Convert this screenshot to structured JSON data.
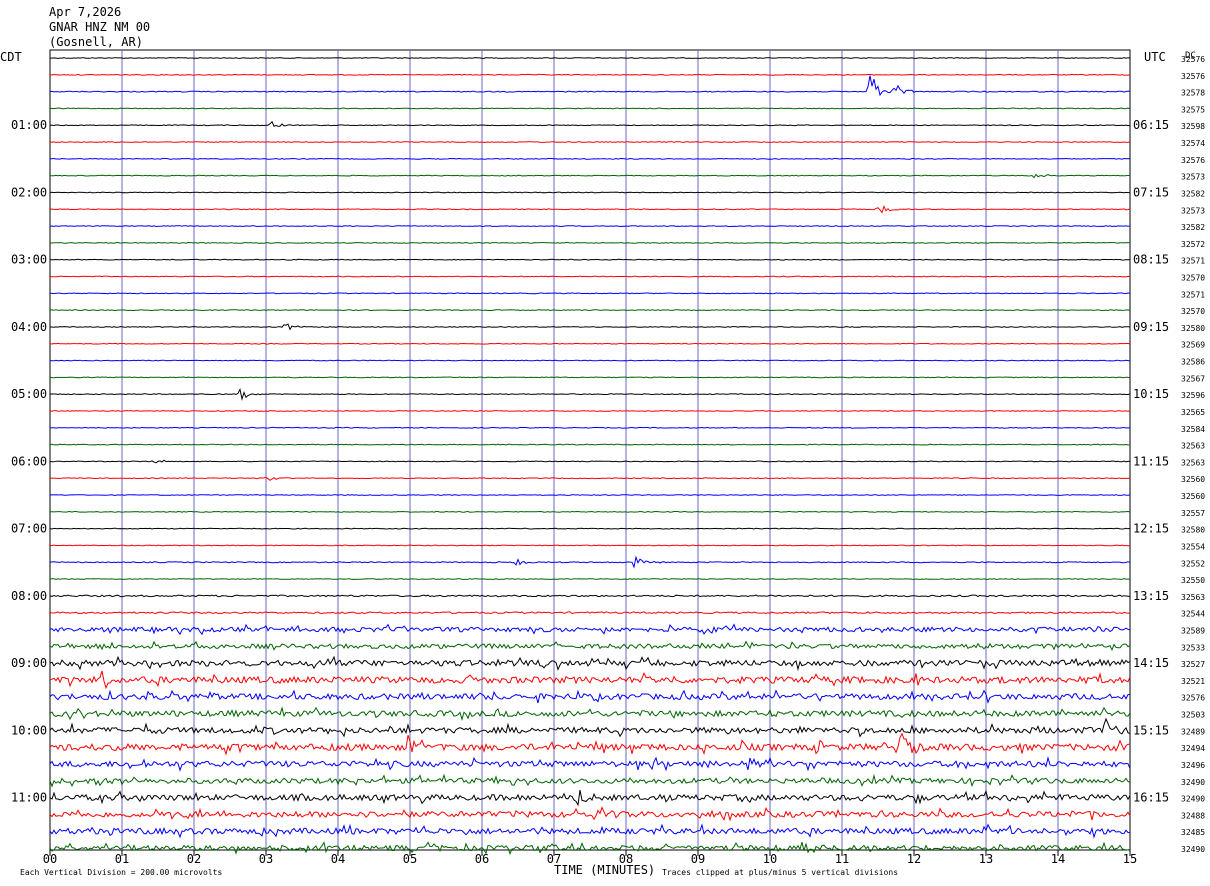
{
  "header": {
    "date": "Apr 7,2026",
    "station": "GNAR HNZ NM 00",
    "location": "(Gosnell, AR)"
  },
  "left_axis_label": "CDT",
  "right_axis_label": "UTC",
  "dc_label": "DC",
  "footer": {
    "scale_note": "Each Vertical Division =  200.00 microvolts",
    "xlabel": "TIME (MINUTES)",
    "clip_note": "Traces clipped at plus/minus 5 vertical divisions"
  },
  "colors": {
    "trace_cycle": [
      "#000000",
      "#ff0000",
      "#0000ff",
      "#006400"
    ],
    "grid": "#6a6ab8"
  },
  "chart_data": {
    "type": "line",
    "title": "",
    "xlabel": "TIME (MINUTES)",
    "ylabel": "",
    "xlim": [
      0,
      15
    ],
    "x_ticks": [
      "00",
      "01",
      "02",
      "03",
      "04",
      "05",
      "06",
      "07",
      "08",
      "09",
      "10",
      "11",
      "12",
      "13",
      "14",
      "15"
    ],
    "trace_count": 48,
    "left_hour_labels": [
      "01:00",
      "02:00",
      "03:00",
      "04:00",
      "05:00",
      "06:00",
      "07:00",
      "08:00",
      "09:00",
      "10:00",
      "11:00"
    ],
    "right_hour_labels": [
      "06:15",
      "07:15",
      "08:15",
      "09:15",
      "10:15",
      "11:15",
      "12:15",
      "13:15",
      "14:15",
      "15:15",
      "16:15"
    ],
    "dc_offsets": [
      "32576",
      "32576",
      "32578",
      "32575",
      "32598",
      "32574",
      "32576",
      "32573",
      "32582",
      "32573",
      "32582",
      "32572",
      "32571",
      "32570",
      "32571",
      "32570",
      "32580",
      "32569",
      "32586",
      "32567",
      "32596",
      "32565",
      "32584",
      "32563",
      "32563",
      "32560",
      "32560",
      "32557",
      "32580",
      "32554",
      "32552",
      "32550",
      "32563",
      "32544",
      "32589",
      "32533",
      "32527",
      "32521",
      "32576",
      "32503",
      "32489",
      "32494",
      "32496",
      "32490",
      "32490",
      "32488",
      "32485",
      "32490"
    ],
    "activity_levels": [
      0.12,
      0.12,
      0.15,
      0.12,
      0.12,
      0.12,
      0.12,
      0.12,
      0.12,
      0.12,
      0.12,
      0.12,
      0.12,
      0.12,
      0.12,
      0.12,
      0.12,
      0.12,
      0.12,
      0.12,
      0.12,
      0.12,
      0.12,
      0.12,
      0.12,
      0.12,
      0.12,
      0.12,
      0.12,
      0.12,
      0.15,
      0.12,
      0.25,
      0.25,
      0.7,
      0.7,
      0.9,
      1.0,
      0.9,
      0.9,
      0.9,
      1.0,
      0.9,
      0.8,
      0.9,
      0.9,
      0.9,
      0.8
    ],
    "events": [
      {
        "trace": 2,
        "minute": 11.4,
        "amplitude": 2.8
      },
      {
        "trace": 2,
        "minute": 11.75,
        "amplitude": 1.2
      },
      {
        "trace": 4,
        "minute": 3.1,
        "amplitude": 0.5
      },
      {
        "trace": 9,
        "minute": 11.5,
        "amplitude": 1.0
      },
      {
        "trace": 7,
        "minute": 13.7,
        "amplitude": 0.4
      },
      {
        "trace": 16,
        "minute": 3.3,
        "amplitude": 0.4
      },
      {
        "trace": 20,
        "minute": 2.65,
        "amplitude": 0.8
      },
      {
        "trace": 24,
        "minute": 1.45,
        "amplitude": 0.4
      },
      {
        "trace": 25,
        "minute": 3.0,
        "amplitude": 0.4
      },
      {
        "trace": 30,
        "minute": 6.5,
        "amplitude": 0.4
      },
      {
        "trace": 30,
        "minute": 8.15,
        "amplitude": 0.7
      },
      {
        "trace": 37,
        "minute": 0.75,
        "amplitude": 1.2
      },
      {
        "trace": 41,
        "minute": 5.0,
        "amplitude": 1.4
      },
      {
        "trace": 41,
        "minute": 11.85,
        "amplitude": 2.0
      },
      {
        "trace": 40,
        "minute": 14.65,
        "amplitude": 2.0
      },
      {
        "trace": 44,
        "minute": 7.35,
        "amplitude": 1.5
      },
      {
        "trace": 45,
        "minute": 7.6,
        "amplitude": 1.0
      },
      {
        "trace": 46,
        "minute": 13.0,
        "amplitude": 0.9
      },
      {
        "trace": 47,
        "minute": 10.45,
        "amplitude": 0.8
      }
    ]
  }
}
